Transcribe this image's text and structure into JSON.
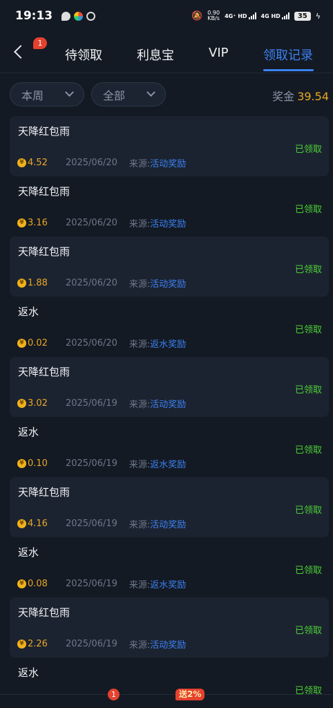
{
  "status_bar": {
    "time": "19:13",
    "speed_value": "0.90",
    "speed_unit": "KB/s",
    "net1": "4G⁺ HD",
    "net2": "4G HD",
    "battery": "35"
  },
  "header": {
    "back_badge": "1",
    "tabs": [
      {
        "label": "待领取"
      },
      {
        "label": "利息宝"
      },
      {
        "label": "VIP"
      },
      {
        "label": "领取记录"
      }
    ]
  },
  "filters": {
    "period": "本周",
    "category": "全部",
    "bonus_label": "奖金",
    "bonus_value": "39.54"
  },
  "coin_symbol": "¥",
  "source_label": "来源:",
  "records": [
    {
      "title": "天降红包雨",
      "amount": "4.52",
      "date": "2025/06/20",
      "source": "活动奖励",
      "status": "已领取"
    },
    {
      "title": "天降红包雨",
      "amount": "3.16",
      "date": "2025/06/20",
      "source": "活动奖励",
      "status": "已领取"
    },
    {
      "title": "天降红包雨",
      "amount": "1.88",
      "date": "2025/06/20",
      "source": "活动奖励",
      "status": "已领取"
    },
    {
      "title": "返水",
      "amount": "0.02",
      "date": "2025/06/20",
      "source": "返水奖励",
      "status": "已领取"
    },
    {
      "title": "天降红包雨",
      "amount": "3.02",
      "date": "2025/06/19",
      "source": "活动奖励",
      "status": "已领取"
    },
    {
      "title": "返水",
      "amount": "0.10",
      "date": "2025/06/19",
      "source": "返水奖励",
      "status": "已领取"
    },
    {
      "title": "天降红包雨",
      "amount": "4.16",
      "date": "2025/06/19",
      "source": "活动奖励",
      "status": "已领取"
    },
    {
      "title": "返水",
      "amount": "0.08",
      "date": "2025/06/19",
      "source": "返水奖励",
      "status": "已领取"
    },
    {
      "title": "天降红包雨",
      "amount": "2.26",
      "date": "2025/06/19",
      "source": "活动奖励",
      "status": "已领取"
    },
    {
      "title": "返水",
      "status": "已领取"
    }
  ],
  "bottom_bar": {
    "badge": "1",
    "gift_badge": "送2%"
  },
  "colors": {
    "background": "#141a23",
    "accent": "#3b82f6",
    "gold": "#e9a825",
    "claimed_green": "#4cd137"
  }
}
